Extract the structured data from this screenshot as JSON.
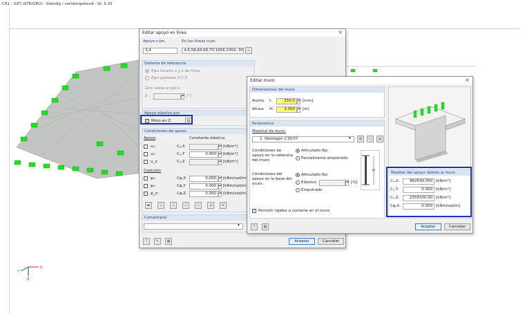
{
  "viewport": {
    "title": "CR1 : GZT (STR/GEO) - Ständig / vorübergehend - Gl. 6.10"
  },
  "colors": {
    "support_green": "#20e020",
    "mesh_gray": "#b8bcb8",
    "highlight": "#1c2fb8",
    "header_blue": "#dce6f2"
  },
  "axes": {
    "x": "X",
    "y": "Y",
    "z": "Z"
  },
  "apoyo_dialog": {
    "title": "Editar apoyo en línea",
    "apoyo_num_label": "Apoyo núm.",
    "apoyo_num_value": "3,4",
    "lineas_label": "En las líneas núm.",
    "lineas_value": "4,6,58,64,68,70,1958,1959; 30,1",
    "sistema_header": "Sistema de referencia",
    "opt_ejes_locales": "Ejes locales x,y,z  de línea",
    "opt_ejes_globales": "Ejes globales X,Y,Z",
    "giro_label": "Giro sobre el eje x:",
    "beta_label": "β :",
    "beta_unit": "[°]",
    "elastico_header": "Apoyo elástico por",
    "muro_label": "Muro en Z",
    "condiciones_header": "Condiciones de apoyo",
    "col_apoyo": "Apoyo",
    "col_constante": "Constante elástica",
    "rows": [
      {
        "sym": "uₓ:",
        "c": "Cᵤ,X",
        "val": "",
        "unit": "[kN/m²]"
      },
      {
        "sym": "uᵧ:",
        "c": "Cᵤ,Y",
        "val": "0.000",
        "unit": "[kN/m²]"
      },
      {
        "sym": "u_z:",
        "c": "Cᵤ,Z",
        "val": "",
        "unit": "[kN/m²]"
      }
    ],
    "coaccion_label": "Coacción",
    "rot_rows": [
      {
        "sym": "φₓ:",
        "c": "Cφ,X",
        "val": "0.000",
        "unit": "[kNm/rad/m]"
      },
      {
        "sym": "φᵧ:",
        "c": "Cφ,Y",
        "val": "0.000",
        "unit": "[kNm/rad/m]"
      },
      {
        "sym": "φ_z:",
        "c": "Cφ,Z",
        "val": "0.000",
        "unit": "[kNm/rad/m]"
      }
    ],
    "comentario_header": "Comentario",
    "ok": "Aceptar",
    "cancel": "Cancelar"
  },
  "muro_dialog": {
    "title": "Editar muro",
    "dim_header": "Dimensiones del muro",
    "ancho_label": "Ancho",
    "ancho_sym": "t:",
    "ancho_value": "250.0",
    "ancho_unit": "[mm]",
    "altura_label": "Altura",
    "altura_sym": "H:",
    "altura_value": "3.000",
    "altura_unit": "[m]",
    "param_header": "Parámetros",
    "material_label": "Material de muro:",
    "material_num": "1",
    "material_value": "Hormigón C30/37",
    "cabecera_label": "Condiciones de apoyo en la cabecera del muro:",
    "cab_opt1": "Articulado fijo",
    "cab_opt2": "Parcialmente empotrado",
    "base_label": "Condiciones del apoyo en la base del muro:",
    "base_opt1": "Articulado fijo",
    "base_opt2": "Elástico:",
    "base_opt3": "Empotrado",
    "base_unit": "[%]",
    "rigidez_label": "Permitir rigidez a cortante en el muro",
    "muelles_header": "Muelles del apoyo debido al muro",
    "muelles": [
      {
        "sym": "Cᵤ,X:",
        "val": "982639.000",
        "unit": "[kN/m²]"
      },
      {
        "sym": "Cᵤ,Y:",
        "val": "0.000",
        "unit": "[kN/m²]"
      },
      {
        "sym": "Cᵤ,Z:",
        "val": "2358330.00",
        "unit": "[kN/m²]"
      },
      {
        "sym": "Cφ,X:",
        "val": "0.000",
        "unit": "[kNm/rad/m]"
      }
    ],
    "ok": "Aceptar",
    "cancel": "Cancelar"
  }
}
